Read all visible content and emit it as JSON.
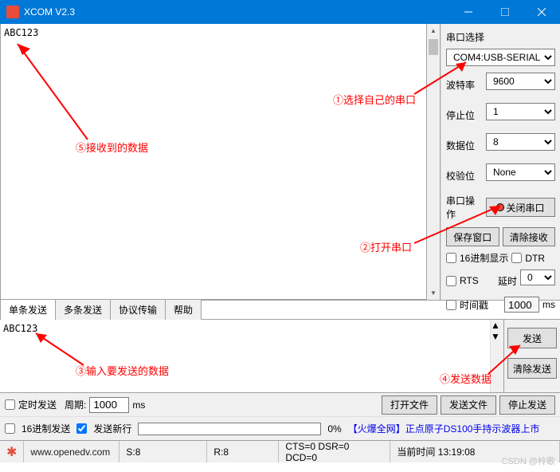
{
  "title": "XCOM V2.3",
  "rx_text": "ABC123",
  "tx_text": "ABC123",
  "side": {
    "heading": "串口选择",
    "port": "COM4:USB-SERIAL",
    "baud_label": "波特率",
    "baud": "9600",
    "stop_label": "停止位",
    "stop": "1",
    "data_label": "数据位",
    "data": "8",
    "parity_label": "校验位",
    "parity": "None",
    "op_label": "串口操作",
    "op_btn": "关闭串口",
    "save_win": "保存窗口",
    "clear_rx": "清除接收",
    "hex_disp": "16进制显示",
    "dtr": "DTR",
    "rts": "RTS",
    "delay_label": "延时",
    "delay": "0",
    "ts_label": "时间戳",
    "ts_val": "1000",
    "ts_unit": "ms"
  },
  "tabs": [
    "单条发送",
    "多条发送",
    "协议传输",
    "帮助"
  ],
  "tx": {
    "send": "发送",
    "clear_send": "清除发送"
  },
  "ctrl": {
    "timed": "定时发送",
    "period_label": "周期:",
    "period": "1000",
    "period_unit": "ms",
    "open_file": "打开文件",
    "send_file": "发送文件",
    "stop_send": "停止发送",
    "hex_send": "16进制发送",
    "newline": "发送新行",
    "progress": "0%",
    "promo": "【火爆全网】正点原子DS100手持示波器上市"
  },
  "status": {
    "url": "www.openedv.com",
    "s": "S:8",
    "r": "R:8",
    "cts": "CTS=0 DSR=0 DCD=0",
    "time_label": "当前时间",
    "time": "13:19:08",
    "watermark": "CSDN @柃歌"
  },
  "annot": {
    "a1": "①选择自己的串口",
    "a2": "②打开串口",
    "a3": "③输入要发送的数据",
    "a4": "④发送数据",
    "a5": "⑤接收到的数据"
  }
}
